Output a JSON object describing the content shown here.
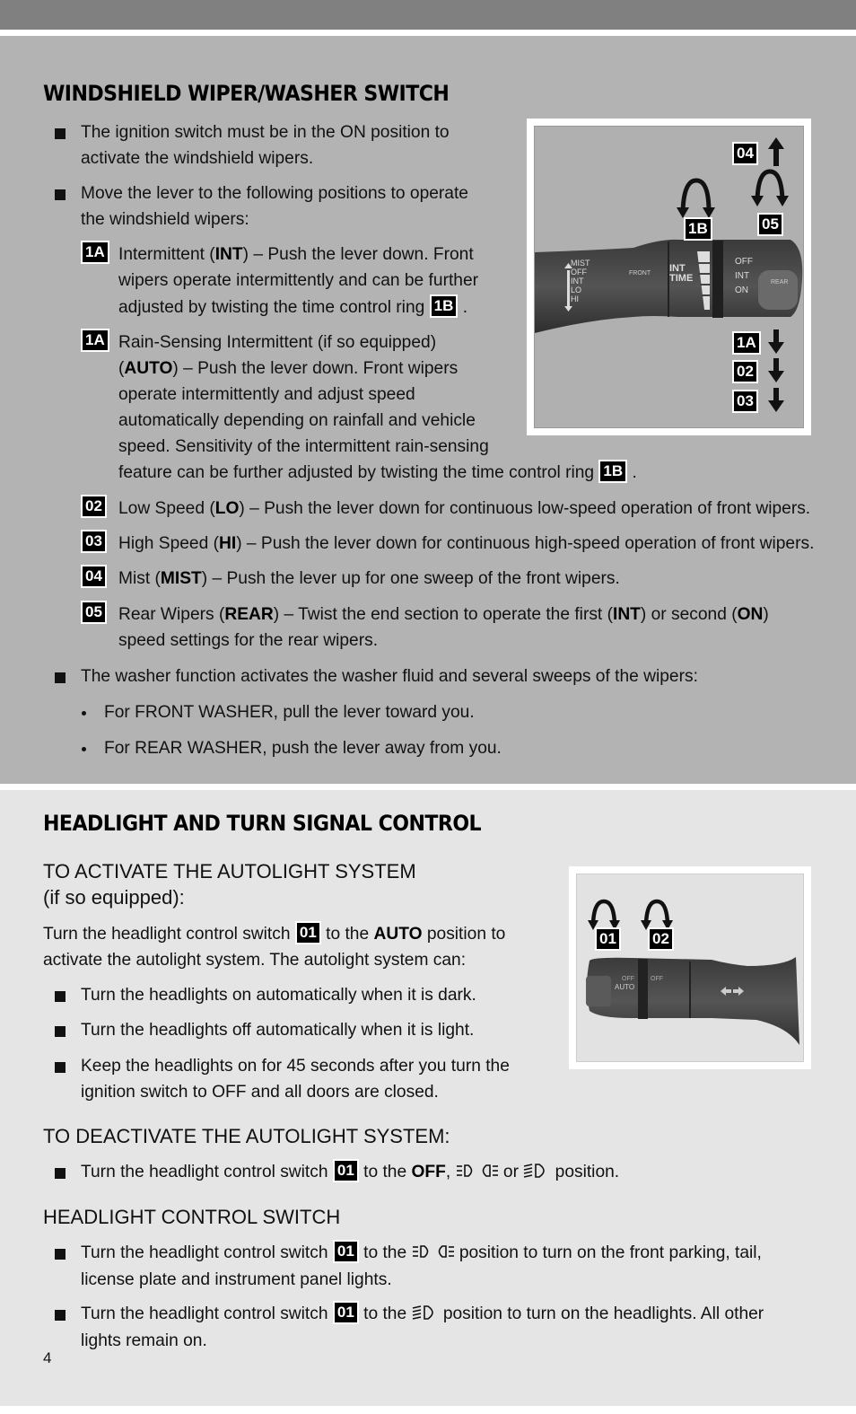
{
  "page_number": "4",
  "colors": {
    "top_bar": "#808080",
    "section1_bg": "#b3b3b3",
    "section2_bg": "#e5e5e5",
    "badge_bg": "#000000"
  },
  "wiper": {
    "title": "WINDSHIELD WIPER/WASHER SWITCH",
    "bullet1": [
      "The ignition switch must be in the ON position to",
      "activate the windshield wipers."
    ],
    "bullet2": [
      "Move the lever to the following positions to operate",
      "the windshield wipers:"
    ],
    "item_1a_int": {
      "badge": "1A",
      "line1_pre": "Intermittent (",
      "line1_bold": "INT",
      "line1_post": ") – Push the lever down. Front",
      "line2": "wipers operate intermittently and can be further",
      "line3": "adjusted by twisting the time control ring",
      "ref_badge": "1B",
      "end": "."
    },
    "item_1a_auto": {
      "badge": "1A",
      "line1": "Rain-Sensing Intermittent (if so equipped)",
      "line2_pre": "(",
      "line2_bold": "AUTO",
      "line2_post": ") – Push the lever down. Front wipers",
      "line3": "operate intermittently and adjust speed",
      "line4": "automatically depending on rainfall and vehicle",
      "line5": "speed. Sensitivity of the intermittent rain-sensing",
      "line6": "feature can be further adjusted by twisting the time control ring",
      "ref_badge": "1B",
      "end": "."
    },
    "item_02": {
      "badge": "02",
      "pre": "Low Speed (",
      "bold": "LO",
      "post": ") – Push the lever down for continuous low-speed operation of front wipers."
    },
    "item_03": {
      "badge": "03",
      "pre": "High Speed (",
      "bold": "HI",
      "post": ") – Push the lever down for continuous high-speed operation of front wipers."
    },
    "item_04": {
      "badge": "04",
      "pre": "Mist (",
      "bold": "MIST",
      "post": ") – Push the lever up for one sweep of the front wipers."
    },
    "item_05": {
      "badge": "05",
      "pre": "Rear Wipers (",
      "bold": "REAR",
      "mid": ") – Twist the end section to operate the first (",
      "bold2": "INT",
      "mid2": ") or second (",
      "bold3": "ON",
      "post": ")",
      "line2": "speed settings for the rear wipers."
    },
    "bullet3": "The washer function activates the washer fluid and several sweeps of the wipers:",
    "sub1": "For FRONT WASHER, pull the lever toward you.",
    "sub2": "For REAR WASHER, push the lever away from you.",
    "figure": {
      "badges": [
        "04",
        "1B",
        "05",
        "1A",
        "02",
        "03"
      ],
      "lever_labels": {
        "mist": "MIST",
        "off": "OFF",
        "int": "INT",
        "lo": "LO",
        "hi": "HI",
        "front": "FRONT",
        "int_time_1": "INT",
        "int_time_2": "TIME",
        "rear_off": "OFF",
        "rear_int": "INT",
        "rear_on": "ON",
        "rear": "REAR"
      }
    }
  },
  "headlight": {
    "title": "HEADLIGHT AND TURN SIGNAL CONTROL",
    "activate_heading": "TO ACTIVATE THE AUTOLIGHT SYSTEM",
    "activate_sub": "(if so equipped):",
    "activate_p1_pre": "Turn the headlight control switch",
    "activate_p1_badge": "01",
    "activate_p1_mid": "to the",
    "activate_p1_bold": "AUTO",
    "activate_p1_post": "position to",
    "activate_p2": "activate the autolight system. The autolight system can:",
    "auto_bullets": [
      "Turn the headlights on automatically when it is dark.",
      "Turn the headlights off automatically when it is light."
    ],
    "auto_bullet3": [
      "Keep the headlights on for 45 seconds after you turn the",
      "ignition switch to OFF and all doors are closed."
    ],
    "deactivate_heading": "TO DEACTIVATE THE AUTOLIGHT SYSTEM:",
    "deactivate_pre": "Turn the headlight control switch",
    "deactivate_badge": "01",
    "deactivate_mid": "to the",
    "deactivate_bold": "OFF",
    "deactivate_comma": ",",
    "deactivate_or": "or",
    "deactivate_post": "position.",
    "switch_heading": "HEADLIGHT CONTROL SWITCH",
    "switch_b1_pre": "Turn the headlight control switch",
    "switch_b1_badge": "01",
    "switch_b1_mid": "to the",
    "switch_b1_post": "position to turn on the front parking, tail,",
    "switch_b1_line2": "license plate and instrument panel lights.",
    "switch_b2_pre": "Turn the headlight control switch",
    "switch_b2_badge": "01",
    "switch_b2_mid": "to the",
    "switch_b2_post": "position to turn on the headlights. All other",
    "switch_b2_line2": "lights remain on.",
    "icons": {
      "parking": "parking-lights-icon",
      "headlight": "headlight-icon"
    },
    "figure": {
      "badges": [
        "01",
        "02"
      ],
      "lever_labels": {
        "off1": "OFF",
        "auto": "AUTO",
        "off2": "OFF"
      }
    }
  }
}
